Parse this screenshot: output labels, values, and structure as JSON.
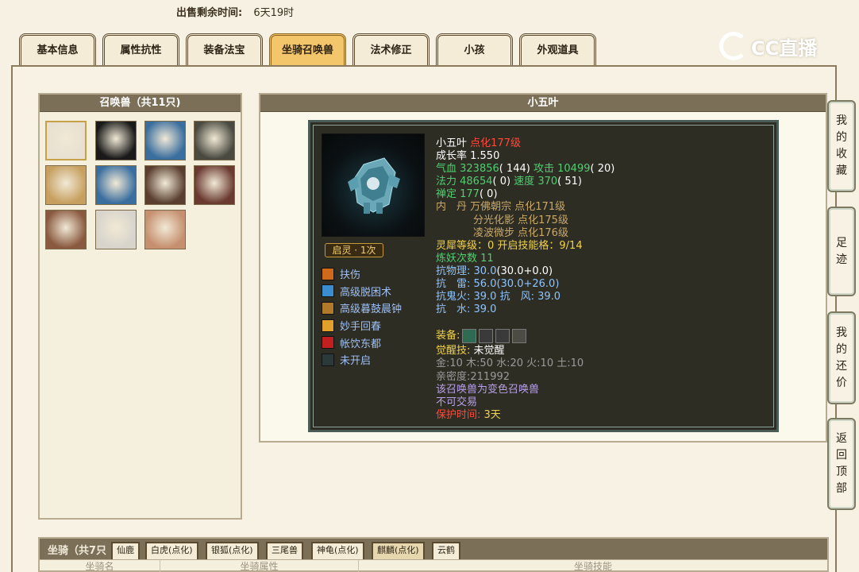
{
  "sale_time": {
    "label": "出售剩余时间:",
    "value": "6天19时"
  },
  "tabs": [
    {
      "label": "基本信息"
    },
    {
      "label": "属性抗性"
    },
    {
      "label": "装备法宝"
    },
    {
      "label": "坐骑召唤兽",
      "active": true
    },
    {
      "label": "法术修正"
    },
    {
      "label": "小孩"
    },
    {
      "label": "外观道具"
    }
  ],
  "logo": {
    "icon": "cc-logo-icon",
    "text": "CC直播"
  },
  "summon_panel": {
    "title": "召唤兽（共11只)",
    "pets": [
      {
        "name": "pet-panda",
        "color": "#e8e0d0",
        "selected": true
      },
      {
        "name": "pet-white-spirit",
        "color": "#1a1a1a"
      },
      {
        "name": "pet-ice-golem",
        "color": "#3a6e9e"
      },
      {
        "name": "pet-black-bear",
        "color": "#4a4a40"
      },
      {
        "name": "pet-golden-eagle",
        "color": "#c7a060"
      },
      {
        "name": "pet-ice-golem-2",
        "color": "#3a6e9e"
      },
      {
        "name": "pet-wolf",
        "color": "#5a3f30"
      },
      {
        "name": "pet-masks",
        "color": "#6a3a30"
      },
      {
        "name": "pet-lady",
        "color": "#8a5a40"
      },
      {
        "name": "pet-white-blob",
        "color": "#d8d4cc"
      },
      {
        "name": "pet-baby",
        "color": "#c69070"
      }
    ]
  },
  "detail": {
    "title": "小五叶",
    "name": "小五叶",
    "dianhua": "点化177级",
    "growth": "成长率 1.550",
    "stats": [
      {
        "a_label": "气血 ",
        "a_val": "323856",
        "a_paren": "( 144)",
        "b_label": " 攻击 ",
        "b_val": "10499",
        "b_paren": "( 20)"
      },
      {
        "a_label": "法力 ",
        "a_val": "48654",
        "a_paren": "( 0)",
        "b_label": " 速度 ",
        "b_val": "370",
        "b_paren": "( 51)"
      }
    ],
    "chanding": {
      "label": "禅定 ",
      "val": "177",
      "paren": "( 0)"
    },
    "neidan": [
      {
        "prefix": "内　丹 ",
        "text": "万佛朝宗 点化171级"
      },
      {
        "prefix": "",
        "text": "分光化影 点化175级"
      },
      {
        "prefix": "",
        "text": "凌波微步 点化176级"
      }
    ],
    "lingxi": "灵犀等级：0 开启技能格：9/14",
    "lianyao": "炼妖次数 11",
    "resist": [
      {
        "label": "抗物理: ",
        "value": "30.0",
        "paren": "(30.0+0.0)"
      },
      {
        "label": "抗　雷: ",
        "value": "56.0",
        "paren": "(30.0+26.0)"
      }
    ],
    "resist_ghost": "抗鬼火: 39.0 抗　风: 39.0",
    "resist_water": "抗　水: 39.0",
    "equip_label": "装备:",
    "equip_slots": [
      {
        "icon": "ring-equip-icon",
        "color": "#2f6a52"
      },
      {
        "icon": "claw-equip-icon",
        "color": "#3a3a3a"
      },
      {
        "icon": "armor-equip-icon",
        "color": "#3a3a3a"
      },
      {
        "icon": "empty-equip-icon",
        "color": "#4c4c44"
      }
    ],
    "awaken": {
      "label": "觉醒技: ",
      "value": "未觉醒"
    },
    "elements": "金:10 木:50 水:20 火:10 土:10",
    "intimacy": "亲密度:211992",
    "variant": "该召唤兽为变色召唤兽",
    "tradable": "不可交易",
    "protect": {
      "label": "保护时间: ",
      "value": "3天"
    },
    "qiling": "启灵 · 1次",
    "skills": [
      {
        "name": "扶伤",
        "icon": "fushang-skill-icon",
        "color": "#d06a1a"
      },
      {
        "name": "高级脱困术",
        "icon": "tuokun-skill-icon",
        "color": "#3a8ed0"
      },
      {
        "name": "高级暮鼓晨钟",
        "icon": "mugu-skill-icon",
        "color": "#b07a2a"
      },
      {
        "name": "妙手回春",
        "icon": "huichun-skill-icon",
        "color": "#e0a02a"
      },
      {
        "name": "帐饮东都",
        "icon": "zhangyin-skill-icon",
        "color": "#c02020"
      },
      {
        "name": "未开启",
        "icon": "locked-skill-icon",
        "color": "#2a3a3a"
      }
    ]
  },
  "mount_section": {
    "title": "坐骑（共7只",
    "tabs": [
      {
        "label": "仙鹿"
      },
      {
        "label": "白虎(点化)"
      },
      {
        "label": "银狐(点化)"
      },
      {
        "label": "三尾兽"
      },
      {
        "label": "神龟(点化)"
      },
      {
        "label": "麒麟(点化)",
        "active": true
      },
      {
        "label": "云鹤"
      }
    ],
    "columns": [
      "坐骑名",
      "坐骑属性",
      "坐骑技能"
    ]
  },
  "side_buttons": [
    {
      "label": "我的收藏",
      "chars": [
        "我",
        "的",
        "收",
        "藏"
      ]
    },
    {
      "label": "足迹",
      "chars": [
        "足",
        "迹"
      ]
    },
    {
      "label": "我的还价",
      "chars": [
        "我",
        "的",
        "还",
        "价"
      ]
    },
    {
      "label": "返回顶部",
      "chars": [
        "返",
        "回",
        "顶",
        "部"
      ]
    }
  ]
}
